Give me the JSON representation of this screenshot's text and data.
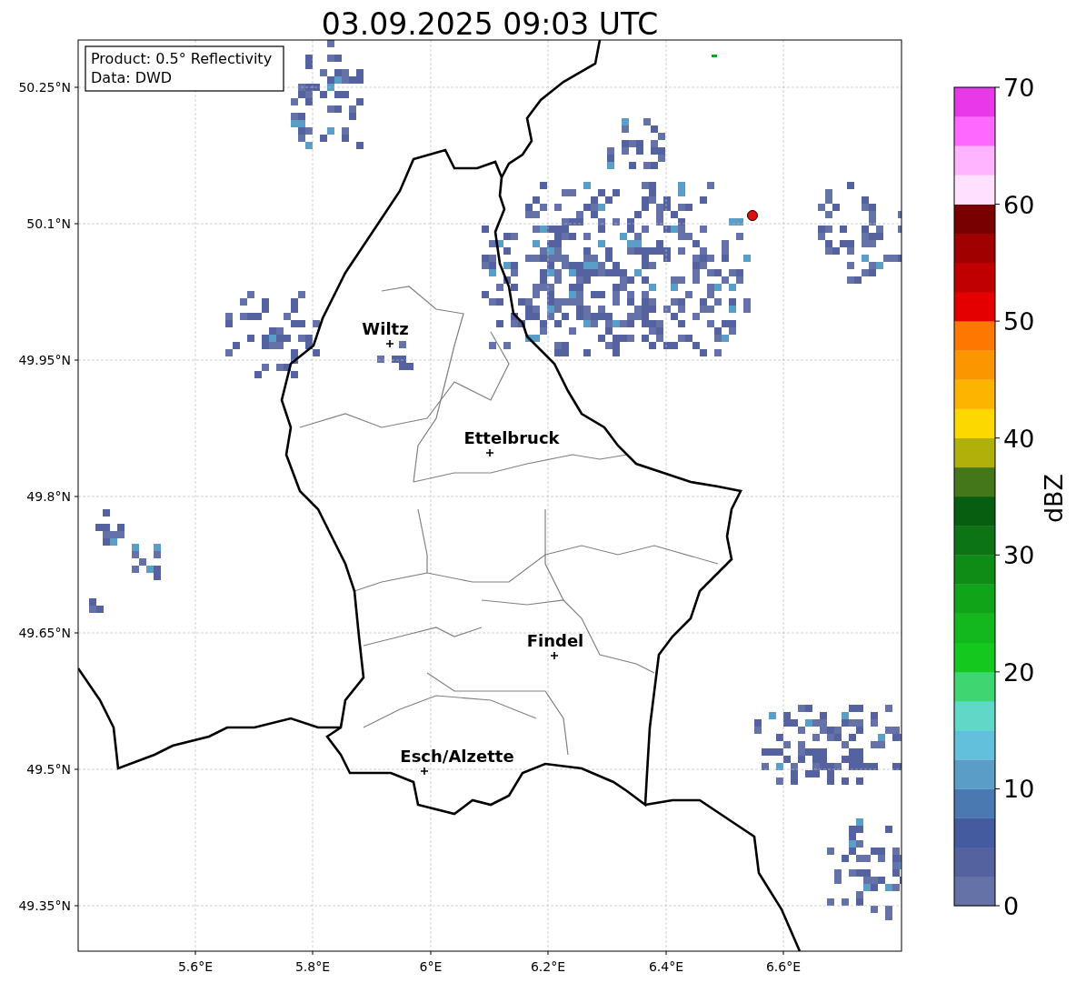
{
  "title": "03.09.2025 09:03 UTC",
  "info_box": [
    "Product: 0.5° Reflectivity",
    "Data: DWD"
  ],
  "map": {
    "x_ticks": [
      "5.6°E",
      "5.8°E",
      "6°E",
      "6.2°E",
      "6.4°E",
      "6.6°E"
    ],
    "y_ticks": [
      "50.25°N",
      "50.1°N",
      "49.95°N",
      "49.8°N",
      "49.65°N",
      "49.5°N",
      "49.35°N"
    ],
    "cities": [
      {
        "name": "Wiltz"
      },
      {
        "name": "Ettelbruck"
      },
      {
        "name": "Findel"
      },
      {
        "name": "Esch/Alzette"
      }
    ]
  },
  "colorbar": {
    "label": "dBZ",
    "ticks": [
      "70",
      "60",
      "50",
      "40",
      "30",
      "20",
      "10",
      "0"
    ],
    "bands": [
      {
        "color": "#6472a8"
      },
      {
        "color": "#5463a0"
      },
      {
        "color": "#445c9f"
      },
      {
        "color": "#4a78b0"
      },
      {
        "color": "#5a9ec8"
      },
      {
        "color": "#62c0dc"
      },
      {
        "color": "#60d8c8"
      },
      {
        "color": "#3ed670"
      },
      {
        "color": "#14c81e"
      },
      {
        "color": "#12b81c"
      },
      {
        "color": "#10a418"
      },
      {
        "color": "#0e8c16"
      },
      {
        "color": "#0c7414"
      },
      {
        "color": "#085e10"
      },
      {
        "color": "#44761a"
      },
      {
        "color": "#b0b00a"
      },
      {
        "color": "#fcd800"
      },
      {
        "color": "#fcb400"
      },
      {
        "color": "#fc9600"
      },
      {
        "color": "#fc7800"
      },
      {
        "color": "#e40000"
      },
      {
        "color": "#c00000"
      },
      {
        "color": "#a00000"
      },
      {
        "color": "#780000"
      },
      {
        "color": "#ffe0ff"
      },
      {
        "color": "#ffb4ff"
      },
      {
        "color": "#ff68ff"
      },
      {
        "color": "#e838e8"
      }
    ]
  }
}
